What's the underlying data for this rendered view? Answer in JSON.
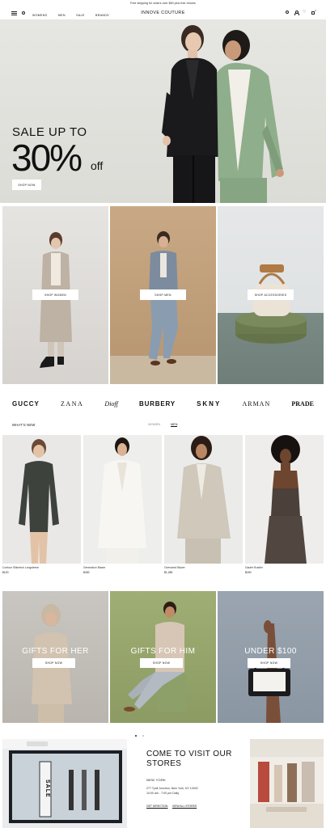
{
  "topbar": {
    "text": "Free shipping for orders over $60 plus free returns"
  },
  "header": {
    "nav": [
      "WOMENS",
      "MEN",
      "SALE",
      "BRANDS"
    ],
    "logo": "INNOVE COUTURE",
    "bag_count": "0",
    "icons": [
      "menu-icon",
      "search-icon",
      "user-icon",
      "heart-icon",
      "bag-icon"
    ]
  },
  "hero": {
    "title": "SALE UP TO",
    "percent": "30%",
    "off": "off",
    "button": "SHOP NOW"
  },
  "categories": [
    {
      "button": "SHOP WOMEN"
    },
    {
      "button": "SHOP MEN"
    },
    {
      "button": "SHOP ACCESSORIES"
    }
  ],
  "brands": [
    "GUCCY",
    "ZANA",
    "Dioff",
    "BURBERY",
    "SKNY",
    "ARMAN",
    "PRADE"
  ],
  "new_section": {
    "title": "WHAT'S NEW",
    "tabs": [
      "WOMEN",
      "MEN"
    ],
    "products": [
      {
        "name": "Contour Silkmesh Longsleeve",
        "price": "$120"
      },
      {
        "name": "Generation Blazer",
        "price": "$430"
      },
      {
        "name": "Oversized Blazer",
        "price": "$1,280"
      },
      {
        "name": "Gaufre Bustier",
        "price": "$150"
      }
    ]
  },
  "gifts": [
    {
      "title": "GIFTS FOR HER",
      "button": "SHOP NOW"
    },
    {
      "title": "GIFTS FOR HIM",
      "button": "SHOP NOW"
    },
    {
      "title": "UNDER $100",
      "button": "SHOP NOW"
    }
  ],
  "stores": {
    "title_line1": "COME TO VISIT OUR",
    "title_line2": "STORES",
    "city": "NEW YORK",
    "address": "277 Tyall Junction, New York, NY 10002",
    "hours": "10:00 am - 7:00 pm Daily",
    "link1": "GET DIRECTION",
    "link2": "VIEW ALL STORES",
    "sign": "SALE"
  }
}
